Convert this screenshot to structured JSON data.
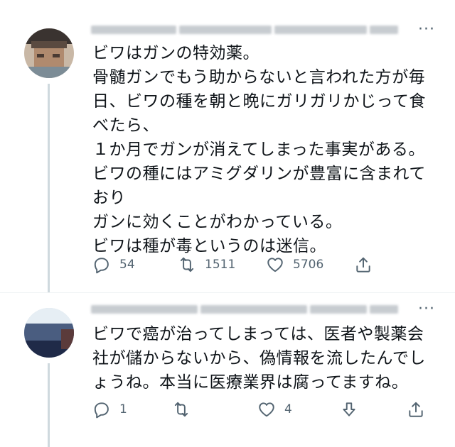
{
  "tweets": [
    {
      "text": "ビワはガンの特効薬。\n骨髄ガンでもう助からないと言われた方が毎日、ビワの種を朝と晩にガリガリかじって食べたら、\n１か月でガンが消えてしまった事実がある。\nビワの種にはアミグダリンが豊富に含まれており\nガンに効くことがわかっている。\nビワは種が毒というのは迷信。",
      "reply_count": "54",
      "retweet_count": "1511",
      "like_count": "5706"
    },
    {
      "text": "ビワで癌が治ってしまっては、医者や製薬会社が儲からないから、偽情報を流したんでしょうね。本当に医療業界は腐ってますね。",
      "reply_count": "1",
      "retweet_count": "",
      "like_count": "4"
    }
  ],
  "icons": {
    "more": "more-horizontal-icon",
    "reply": "reply-icon",
    "retweet": "retweet-icon",
    "like": "heart-icon",
    "downvote": "downvote-icon",
    "share": "share-icon"
  }
}
